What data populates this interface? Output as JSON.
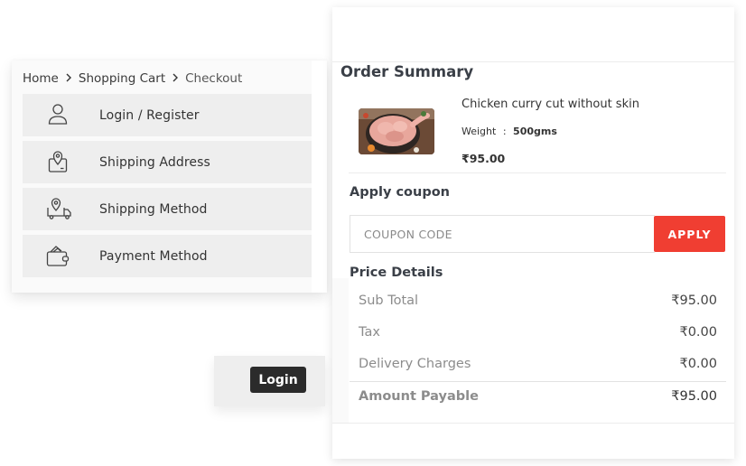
{
  "breadcrumb": {
    "items": [
      "Home",
      "Shopping Cart",
      "Checkout"
    ],
    "separator_icon": "chevron-right-icon"
  },
  "steps": [
    {
      "label": "Login / Register",
      "icon": "user-icon"
    },
    {
      "label": "Shipping Address",
      "icon": "location-box-icon"
    },
    {
      "label": "Shipping Method",
      "icon": "delivery-truck-icon"
    },
    {
      "label": "Payment Method",
      "icon": "wallet-icon"
    }
  ],
  "login_button": "Login",
  "summary": {
    "title": "Order Summary",
    "product": {
      "name": "Chicken curry cut without skin",
      "weight_label": "Weight",
      "weight_sep": ":",
      "weight_value": "500gms",
      "price": "₹95.00",
      "image": "chicken-curry-cut-image"
    },
    "coupon": {
      "title": "Apply coupon",
      "placeholder": "COUPON CODE",
      "value": "",
      "apply_label": "APPLY"
    },
    "price_details": {
      "title": "Price Details",
      "rows": [
        {
          "label": "Sub Total",
          "value": "₹95.00"
        },
        {
          "label": "Tax",
          "value": "₹0.00"
        },
        {
          "label": "Delivery Charges",
          "value": "₹0.00"
        }
      ],
      "total": {
        "label": "Amount Payable",
        "value": "₹95.00"
      }
    }
  },
  "colors": {
    "accent": "#f03e32",
    "dark_button": "#2b2b2b",
    "step_background": "#eeeeee",
    "heading": "#3a3f47"
  }
}
